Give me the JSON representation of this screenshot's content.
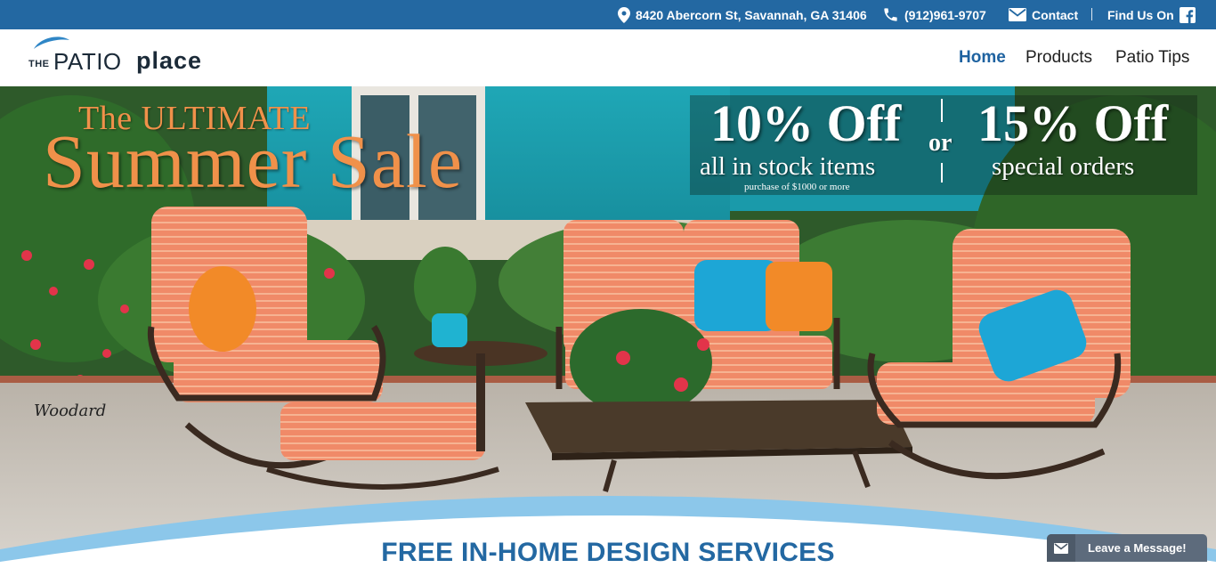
{
  "topbar": {
    "address": "8420 Abercorn St, Savannah, GA 31406",
    "phone": "(912)961-9707",
    "contact": "Contact",
    "find_us": "Find Us On",
    "icons": [
      "location-pin-icon",
      "phone-icon",
      "envelope-icon",
      "facebook-icon"
    ]
  },
  "header": {
    "logo": {
      "the": "THE",
      "patio": "PATIO",
      "place": "place"
    },
    "nav": [
      "Home",
      "Products",
      "Patio Tips"
    ]
  },
  "hero": {
    "title_small": "The ULTIMATE",
    "title_big": "Summer Sale",
    "offer_left_big": "10% Off",
    "offer_left_mid": "all in stock items",
    "offer_left_small": "purchase of $1000 or more",
    "offer_or": "or",
    "offer_right_big": "15% Off",
    "offer_right_mid": "special orders",
    "signature": "Woodard"
  },
  "main": {
    "heading": "FREE IN-HOME DESIGN SERVICES"
  },
  "chat": {
    "label": "Leave a Message!"
  },
  "colors": {
    "topbar": "#2368a2",
    "accent": "#1e62a0",
    "sale_orange": "#f0914a"
  }
}
